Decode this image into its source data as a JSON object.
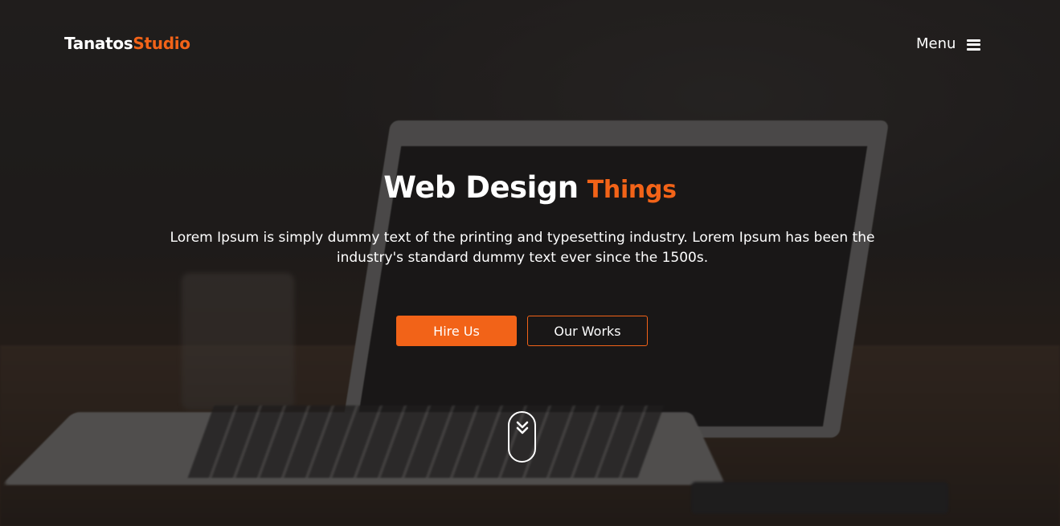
{
  "header": {
    "logo_primary": "Tanatos",
    "logo_accent": "Studio",
    "menu_label": "Menu",
    "menu_icon": "hamburger-icon"
  },
  "hero": {
    "title_primary": "Web Design",
    "title_accent": "Things",
    "lead": "Lorem Ipsum is simply dummy text of the printing and typesetting industry. Lorem Ipsum has been the industry's standard dummy text ever since the 1500s.",
    "primary_button": "Hire Us",
    "secondary_button": "Our Works",
    "scroll_icon": "chevron-double-down-icon"
  },
  "colors": {
    "accent": "#f26318",
    "text": "#ffffff",
    "overlay": "#141212"
  }
}
